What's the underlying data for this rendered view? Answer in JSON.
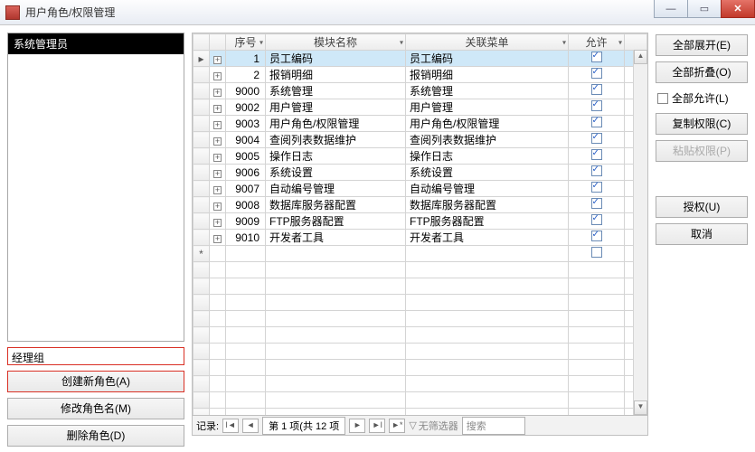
{
  "window": {
    "title": "用户角色/权限管理"
  },
  "roles": {
    "selected": "系统管理员",
    "input_value": "经理组"
  },
  "role_buttons": {
    "create": "创建新角色(A)",
    "rename": "修改角色名(M)",
    "delete": "删除角色(D)"
  },
  "grid": {
    "headers": {
      "seq": "序号",
      "module": "模块名称",
      "menu": "关联菜单",
      "allow": "允许"
    },
    "rows": [
      {
        "seq": "1",
        "module": "员工编码",
        "menu": "员工编码",
        "allow": true,
        "selected": true
      },
      {
        "seq": "2",
        "module": "报销明细",
        "menu": "报销明细",
        "allow": true
      },
      {
        "seq": "9000",
        "module": "系统管理",
        "menu": "系统管理",
        "allow": true
      },
      {
        "seq": "9002",
        "module": "用户管理",
        "menu": "用户管理",
        "allow": true
      },
      {
        "seq": "9003",
        "module": "用户角色/权限管理",
        "menu": "用户角色/权限管理",
        "allow": true
      },
      {
        "seq": "9004",
        "module": "查阅列表数据维护",
        "menu": "查阅列表数据维护",
        "allow": true
      },
      {
        "seq": "9005",
        "module": "操作日志",
        "menu": "操作日志",
        "allow": true
      },
      {
        "seq": "9006",
        "module": "系统设置",
        "menu": "系统设置",
        "allow": true
      },
      {
        "seq": "9007",
        "module": "自动编号管理",
        "menu": "自动编号管理",
        "allow": true
      },
      {
        "seq": "9008",
        "module": "数据库服务器配置",
        "menu": "数据库服务器配置",
        "allow": true
      },
      {
        "seq": "9009",
        "module": "FTP服务器配置",
        "menu": "FTP服务器配置",
        "allow": true
      },
      {
        "seq": "9010",
        "module": "开发者工具",
        "menu": "开发者工具",
        "allow": true
      }
    ],
    "new_row_marker": "*"
  },
  "navbar": {
    "label": "记录:",
    "position": "第 1 项(共 12 项",
    "filter": "无筛选器",
    "search": "搜索"
  },
  "right": {
    "expand_all": "全部展开(E)",
    "collapse_all": "全部折叠(O)",
    "allow_all": "全部允许(L)",
    "copy_perm": "复制权限(C)",
    "paste_perm": "粘贴权限(P)",
    "authorize": "授权(U)",
    "cancel": "取消"
  }
}
